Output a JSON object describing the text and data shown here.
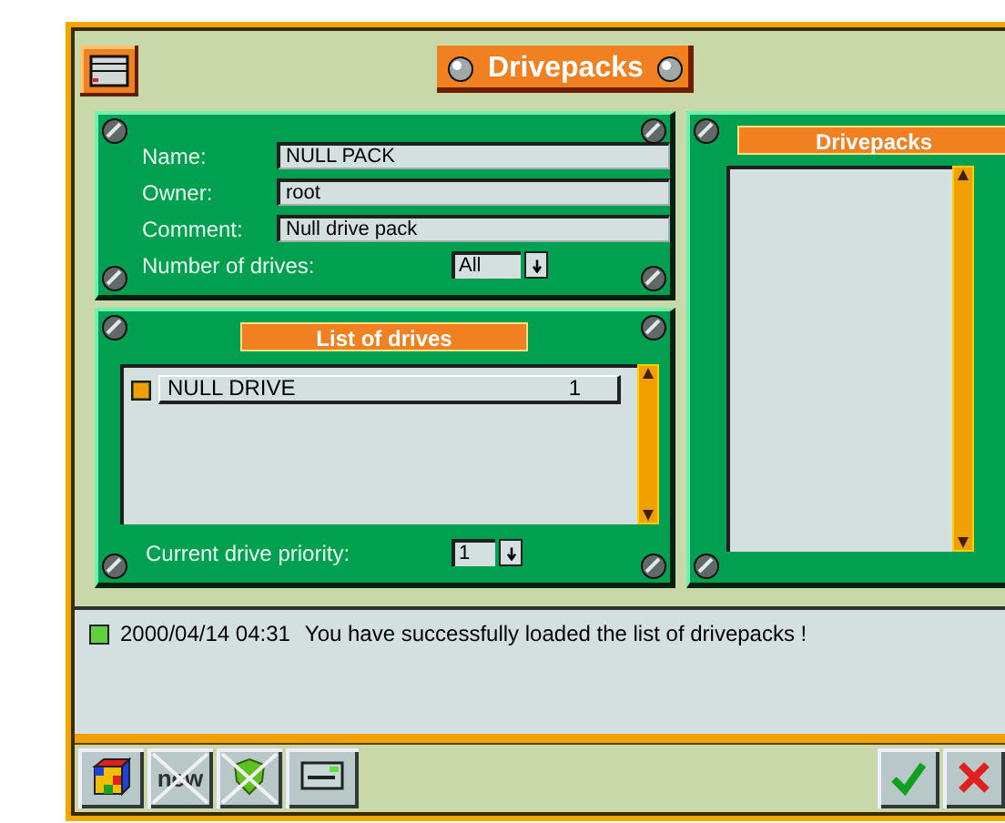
{
  "window": {
    "title": "Drivepacks"
  },
  "pack_form": {
    "fields": [
      {
        "label": "Name:",
        "value": "NULL PACK"
      },
      {
        "label": "Owner:",
        "value": "root"
      },
      {
        "label": "Comment:",
        "value": "Null drive pack"
      }
    ],
    "drive_count": {
      "label": "Number of drives:",
      "value": "All"
    }
  },
  "drive_list": {
    "title": "List of drives",
    "items": [
      {
        "name": "NULL DRIVE",
        "priority": "1"
      }
    ],
    "priority": {
      "label": "Current drive priority:",
      "value": "1"
    }
  },
  "drivepacks_panel": {
    "title": "Drivepacks"
  },
  "log": [
    {
      "time": "2000/04/14 04:31",
      "message": "You have successfully loaded the list of drivepacks !",
      "color": "#60d040"
    }
  ],
  "toolbar": [
    {
      "kind": "cube",
      "disabled": false
    },
    {
      "kind": "new",
      "label": "new",
      "disabled": true
    },
    {
      "kind": "shield",
      "disabled": true
    },
    {
      "kind": "panel",
      "disabled": false
    }
  ],
  "actions": [
    {
      "kind": "ok"
    },
    {
      "kind": "cancel"
    }
  ]
}
